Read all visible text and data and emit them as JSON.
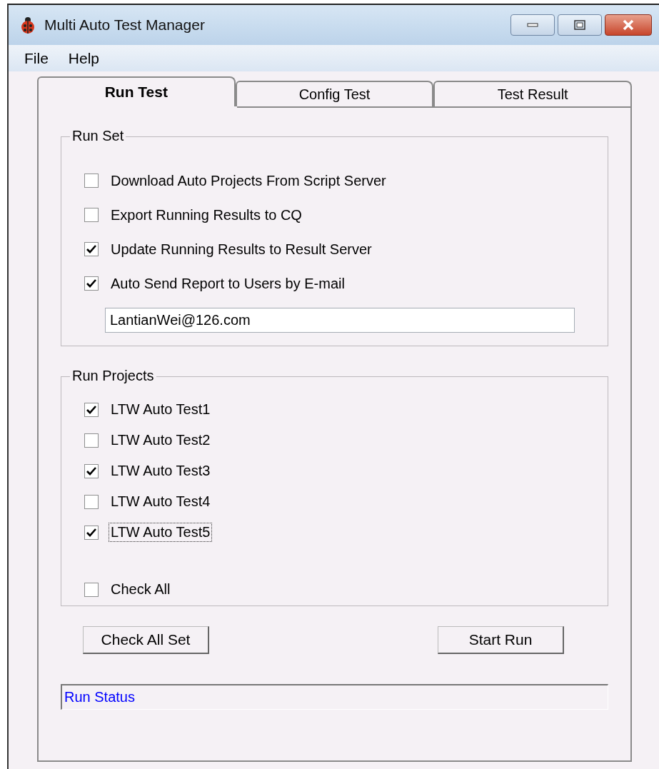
{
  "window": {
    "title": "Multi Auto Test Manager"
  },
  "menu": [
    "File",
    "Help"
  ],
  "tabs": [
    {
      "label": "Run Test",
      "selected": true
    },
    {
      "label": "Config Test",
      "selected": false
    },
    {
      "label": "Test Result",
      "selected": false
    }
  ],
  "run_set": {
    "title": "Run Set",
    "options": [
      {
        "label": "Download Auto Projects From Script Server",
        "checked": false
      },
      {
        "label": "Export Running Results to CQ",
        "checked": false
      },
      {
        "label": "Update Running Results to Result Server",
        "checked": true
      },
      {
        "label": "Auto Send Report to Users by E-mail",
        "checked": true
      }
    ],
    "email": "LantianWei@126.com"
  },
  "run_projects": {
    "title": "Run Projects",
    "projects": [
      {
        "label": "LTW Auto Test1",
        "checked": true,
        "focused": false
      },
      {
        "label": "LTW Auto Test2",
        "checked": false,
        "focused": false
      },
      {
        "label": "LTW Auto Test3",
        "checked": true,
        "focused": false
      },
      {
        "label": "LTW Auto Test4",
        "checked": false,
        "focused": false
      },
      {
        "label": "LTW Auto Test5",
        "checked": true,
        "focused": true
      }
    ],
    "check_all": {
      "label": "Check All",
      "checked": false
    }
  },
  "buttons": [
    "Check All Set",
    "Start Run"
  ],
  "status": "Run Status"
}
